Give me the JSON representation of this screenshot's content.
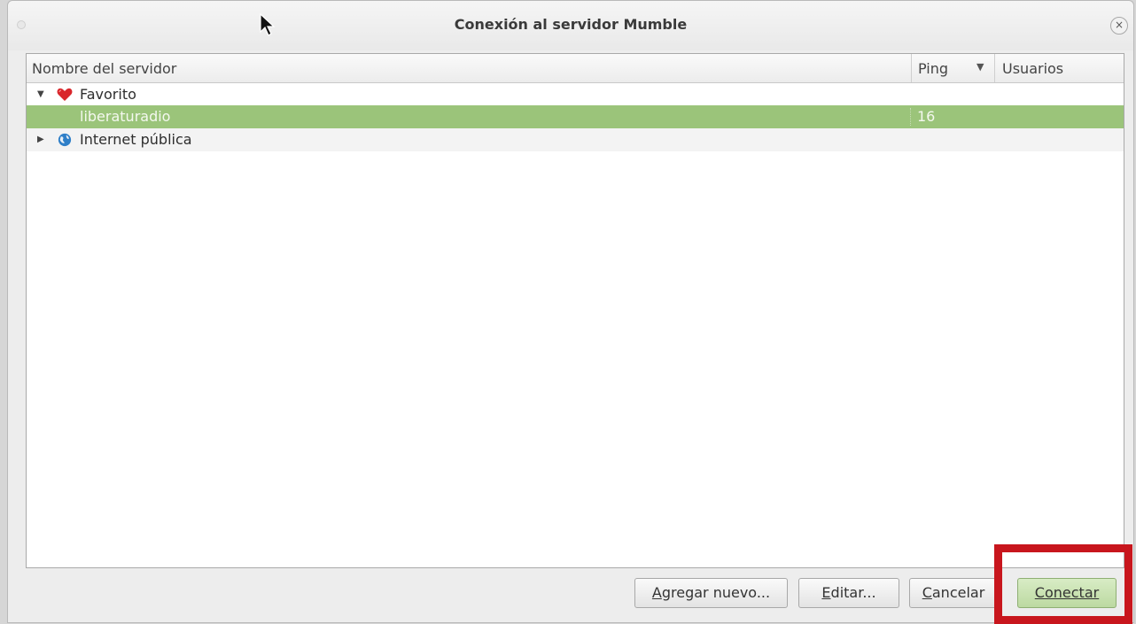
{
  "window": {
    "title": "Conexión al servidor Mumble",
    "close_glyph": "×"
  },
  "tree": {
    "columns": {
      "name": "Nombre del servidor",
      "ping": "Ping",
      "users": "Usuarios"
    },
    "sort_indicator": "▼",
    "rows": [
      {
        "label": "Favorito",
        "expander": "▼",
        "icon": "heart-icon",
        "expanded": true
      },
      {
        "label": "liberaturadio",
        "ping": "16",
        "selected": true
      },
      {
        "label": "Internet pública",
        "expander": "▶",
        "icon": "globe-icon",
        "expanded": false
      }
    ]
  },
  "buttons": {
    "add_new": {
      "mnemonic": "A",
      "rest": "gregar nuevo..."
    },
    "edit": {
      "mnemonic": "E",
      "rest": "ditar..."
    },
    "cancel": {
      "mnemonic": "C",
      "rest": "ancelar"
    },
    "connect": {
      "mnemonic": "C",
      "rest": "onectar"
    }
  },
  "colors": {
    "selection": "#9bc47a",
    "annotation": "#c8161d",
    "heart": "#d9262b",
    "globe": "#2f7fc8"
  }
}
